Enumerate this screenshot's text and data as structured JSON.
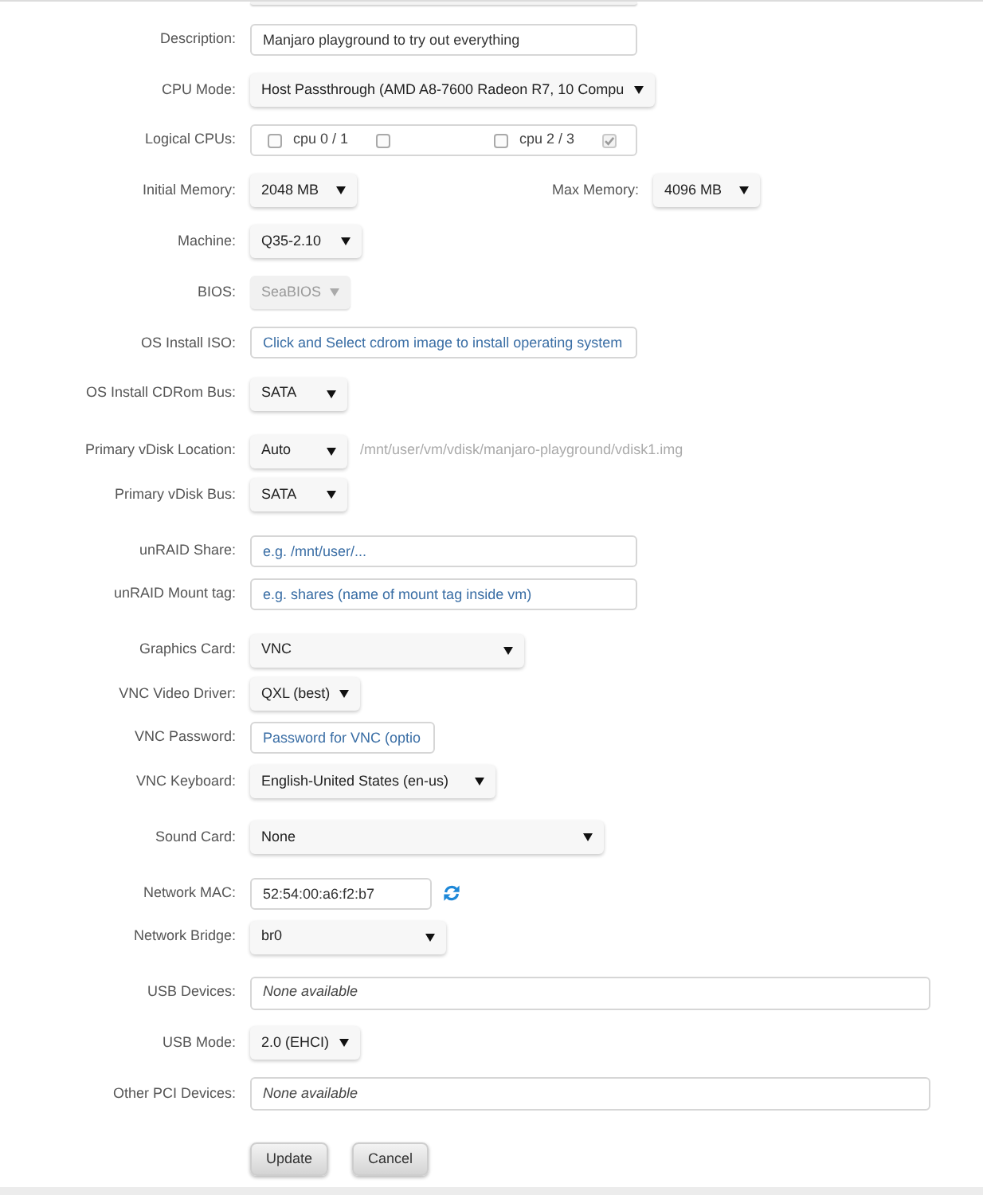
{
  "sections": [
    {
      "rows": [
        {
          "kind": "input",
          "label": "Description:",
          "value": "Manjaro playground to try out everything"
        },
        {
          "kind": "select",
          "label": "CPU Mode:",
          "value": "Host Passthrough (AMD A8-7600 Radeon R7, 10 Compu",
          "disabled": false
        },
        {
          "kind": "checkboxes",
          "label": "Logical CPUs:",
          "pairs": [
            {
              "label": "cpu 0 / 1",
              "boxes": [
                {
                  "checked": false,
                  "disabled": false
                },
                {
                  "checked": false,
                  "disabled": false
                }
              ]
            },
            {
              "label": "cpu 2 / 3",
              "boxes": [
                {
                  "checked": false,
                  "disabled": false
                },
                {
                  "checked": true,
                  "disabled": true
                }
              ]
            }
          ]
        },
        {
          "kind": "select_pair",
          "label": "Initial Memory:",
          "value": "2048 MB",
          "disabled": false,
          "second": {
            "label": "Max Memory:",
            "value": "4096 MB",
            "disabled": false
          }
        },
        {
          "kind": "select",
          "label": "Machine:",
          "value": "Q35-2.10",
          "disabled": false
        },
        {
          "kind": "select",
          "label": "BIOS:",
          "value": "SeaBIOS",
          "disabled": true
        },
        {
          "kind": "input",
          "label": "OS Install ISO:",
          "placeholder": "Click and Select cdrom image to install operating system"
        },
        {
          "kind": "select",
          "label": "OS Install CDRom Bus:",
          "value": "SATA",
          "disabled": false
        }
      ]
    },
    {
      "rows": [
        {
          "kind": "select",
          "label": "Primary vDisk Location:",
          "value": "Auto",
          "disabled": false,
          "note": "/mnt/user/vm/vdisk/manjaro-playground/vdisk1.img"
        },
        {
          "kind": "select",
          "label": "Primary vDisk Bus:",
          "value": "SATA",
          "disabled": false
        }
      ]
    },
    {
      "rows": [
        {
          "kind": "input",
          "label": "unRAID Share:",
          "placeholder": "e.g. /mnt/user/..."
        },
        {
          "kind": "input",
          "label": "unRAID Mount tag:",
          "placeholder": "e.g. shares (name of mount tag inside vm)"
        }
      ]
    },
    {
      "rows": [
        {
          "kind": "select",
          "label": "Graphics Card:",
          "value": "VNC",
          "disabled": false
        },
        {
          "kind": "select",
          "label": "VNC Video Driver:",
          "value": "QXL (best)",
          "disabled": false
        },
        {
          "kind": "input",
          "label": "VNC Password:",
          "placeholder": "Password for VNC (optio"
        },
        {
          "kind": "select",
          "label": "VNC Keyboard:",
          "value": "English-United States (en-us)",
          "disabled": false
        }
      ]
    },
    {
      "rows": [
        {
          "kind": "select",
          "label": "Sound Card:",
          "value": "None",
          "disabled": false
        }
      ]
    },
    {
      "rows": [
        {
          "kind": "input",
          "label": "Network MAC:",
          "value": "52:54:00:a6:f2:b7",
          "refresh": true
        },
        {
          "kind": "select",
          "label": "Network Bridge:",
          "value": "br0",
          "disabled": false
        }
      ]
    },
    {
      "rows": [
        {
          "kind": "list",
          "label": "USB Devices:",
          "text": "None available"
        },
        {
          "kind": "select",
          "label": "USB Mode:",
          "value": "2.0 (EHCI)",
          "disabled": false
        },
        {
          "kind": "list",
          "label": "Other PCI Devices:",
          "text": "None available"
        }
      ]
    }
  ],
  "buttons": [
    "Update",
    "Cancel"
  ]
}
